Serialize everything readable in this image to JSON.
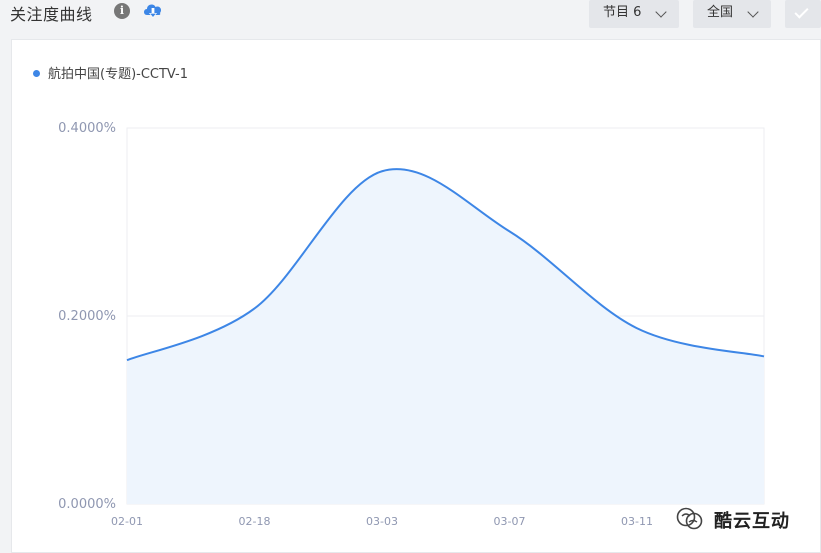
{
  "header": {
    "title": "关注度曲线",
    "program_dropdown": "节目 6",
    "region_dropdown": "全国"
  },
  "chart_data": {
    "type": "area",
    "series": [
      {
        "name": "航拍中国(专题)-CCTV-1",
        "color": "#3d86e6",
        "fill": "#eef5fd",
        "points": [
          {
            "x": "02-01",
            "y": 0.153
          },
          {
            "x": "02-18",
            "y": 0.208
          },
          {
            "x": "03-03",
            "y": 0.354
          },
          {
            "x": "03-07",
            "y": 0.29
          },
          {
            "x": "03-11",
            "y": 0.187
          },
          {
            "x": "03-15",
            "y": 0.157
          }
        ]
      }
    ],
    "x_ticks": [
      "02-01",
      "02-18",
      "03-03",
      "03-07",
      "03-11"
    ],
    "y_ticks": [
      "0.0000%",
      "0.2000%",
      "0.4000%"
    ],
    "ylim": [
      0,
      0.4
    ],
    "grid": true,
    "legend_position": "top-left"
  },
  "watermark": {
    "text": "酷云互动"
  }
}
